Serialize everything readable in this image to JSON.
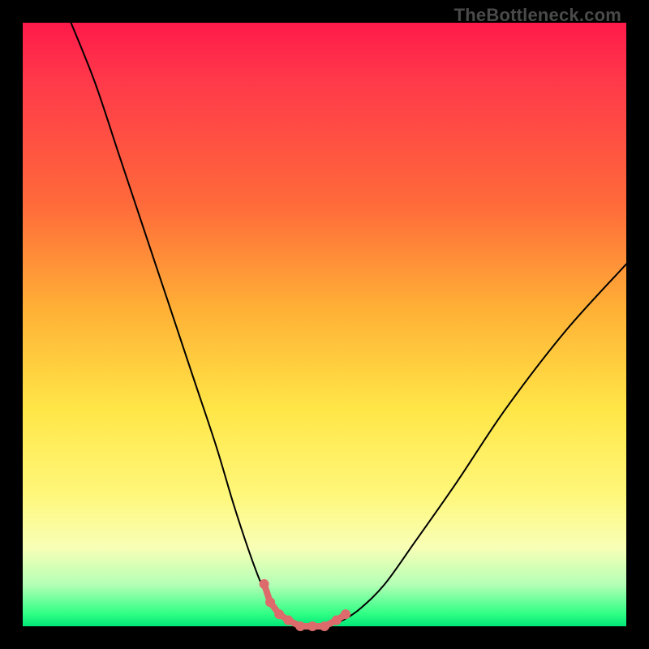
{
  "watermark": "TheBottleneck.com",
  "chart_data": {
    "type": "line",
    "title": "",
    "xlabel": "",
    "ylabel": "",
    "xlim": [
      0,
      100
    ],
    "ylim": [
      0,
      100
    ],
    "grid": false,
    "legend": false,
    "background_gradient": {
      "direction": "vertical",
      "stops": [
        {
          "pos": 0,
          "color": "#ff1a4a"
        },
        {
          "pos": 30,
          "color": "#ff6a3a"
        },
        {
          "pos": 64,
          "color": "#ffe647"
        },
        {
          "pos": 93,
          "color": "#b6ffb6"
        },
        {
          "pos": 100,
          "color": "#00e676"
        }
      ]
    },
    "series": [
      {
        "name": "bottleneck-curve",
        "style": "black-thin",
        "x": [
          8,
          12,
          16,
          20,
          24,
          28,
          32,
          35,
          38,
          40,
          42,
          44,
          46,
          48,
          50,
          53,
          56,
          60,
          65,
          72,
          80,
          90,
          100
        ],
        "y": [
          100,
          90,
          78,
          66,
          54,
          42,
          30,
          20,
          11,
          6,
          3,
          1,
          0,
          0,
          0,
          1,
          3,
          7,
          14,
          24,
          36,
          49,
          60
        ]
      },
      {
        "name": "sweet-spot-markers",
        "style": "salmon-dots",
        "x": [
          40,
          41,
          42.5,
          44,
          46,
          48,
          50,
          52,
          53.5
        ],
        "y": [
          7,
          4,
          2,
          1,
          0,
          0,
          0,
          1,
          2
        ]
      }
    ],
    "annotations": []
  }
}
